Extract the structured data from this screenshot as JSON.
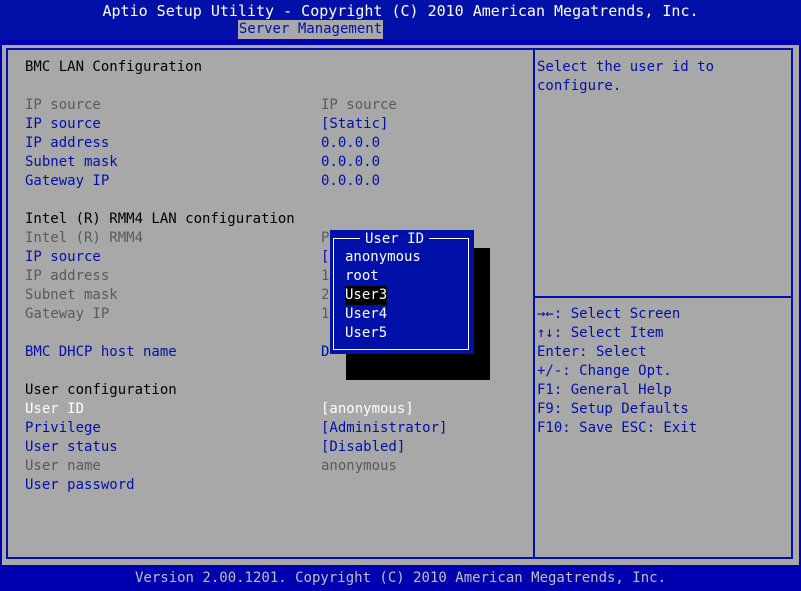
{
  "header": {
    "title": "Aptio Setup Utility - Copyright (C) 2010 American Megatrends, Inc.",
    "active_tab": "Server Management"
  },
  "main": {
    "bmc_lan": {
      "heading": "BMC LAN Configuration",
      "rows": [
        {
          "label": "IP source",
          "value": "IP source"
        },
        {
          "label": "IP source",
          "value": "[Static]"
        },
        {
          "label": "IP address",
          "value": "0.0.0.0"
        },
        {
          "label": "Subnet mask",
          "value": "0.0.0.0"
        },
        {
          "label": "Gateway IP",
          "value": "0.0.0.0"
        }
      ]
    },
    "rmm4_lan": {
      "heading": "Intel (R) RMM4 LAN configuration",
      "rows": [
        {
          "label": "Intel (R) RMM4",
          "value": "P"
        },
        {
          "label": "IP source",
          "value": "["
        },
        {
          "label": "IP address",
          "value": "1"
        },
        {
          "label": "Subnet mask",
          "value": "2"
        },
        {
          "label": "Gateway IP",
          "value": "1"
        }
      ]
    },
    "dhcp": {
      "label": "BMC DHCP host name",
      "value": "D"
    },
    "user_config": {
      "heading": "User configuration",
      "rows": [
        {
          "label": "User ID",
          "value": "[anonymous]"
        },
        {
          "label": "Privilege",
          "value": "[Administrator]"
        },
        {
          "label": "User status",
          "value": "[Disabled]"
        },
        {
          "label": "User name",
          "value": "anonymous"
        },
        {
          "label": "User password",
          "value": ""
        }
      ]
    }
  },
  "help": {
    "description": [
      "Select the user id to",
      "configure."
    ],
    "keys": [
      "→←: Select Screen",
      "↑↓: Select Item",
      "Enter: Select",
      "+/-: Change Opt.",
      "F1: General Help",
      "F9: Setup Defaults",
      "F10: Save  ESC: Exit"
    ]
  },
  "popup": {
    "title": "User ID",
    "options": [
      "anonymous",
      "root",
      "User3",
      "User4",
      "User5"
    ],
    "selected": "User3"
  },
  "footer": {
    "version": "Version 2.00.1201. Copyright (C) 2010 American Megatrends, Inc."
  },
  "colors": {
    "frame_blue": "#0010a8",
    "panel_gray": "#a8a8a8",
    "disabled_gray": "#5a5a5a"
  }
}
